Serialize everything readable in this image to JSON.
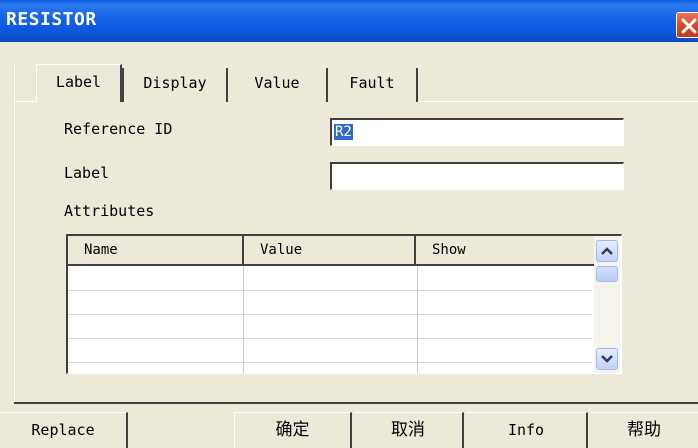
{
  "window": {
    "title": "RESISTOR",
    "close_icon": "close-icon"
  },
  "tabs": [
    {
      "label": "Label",
      "active": true
    },
    {
      "label": "Display",
      "active": false
    },
    {
      "label": "Value",
      "active": false
    },
    {
      "label": "Fault",
      "active": false
    }
  ],
  "form": {
    "reference_id_label": "Reference ID",
    "reference_id_value": "R2",
    "label_label": "Label",
    "label_value": "",
    "attributes_label": "Attributes"
  },
  "attributes_table": {
    "columns": [
      "Name",
      "Value",
      "Show"
    ],
    "rows": []
  },
  "buttons": {
    "replace": "Replace",
    "ok": "确定",
    "cancel": "取消",
    "info": "Info",
    "help": "帮助"
  }
}
